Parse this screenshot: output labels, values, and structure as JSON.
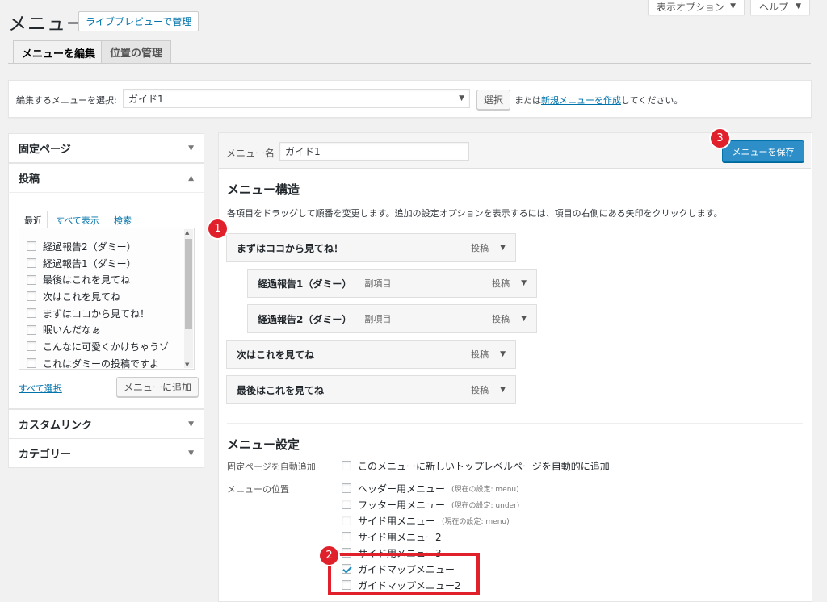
{
  "header": {
    "title": "メニュー",
    "live_preview_button": "ライブプレビューで管理",
    "screen_options": "表示オプション",
    "help": "ヘルプ",
    "caret": "▼"
  },
  "tabs": [
    {
      "label": "メニューを編集",
      "active": true
    },
    {
      "label": "位置の管理",
      "active": false
    }
  ],
  "select_bar": {
    "label": "編集するメニューを選択:",
    "selected": "ガイド1",
    "select_button": "選択",
    "or_text": "または",
    "create_link": "新規メニューを作成",
    "suffix": "してください。"
  },
  "left_panel": {
    "pages_title": "固定ページ",
    "posts_title": "投稿",
    "post_tabs": [
      "最近",
      "すべて表示",
      "検索"
    ],
    "posts": [
      "経過報告2（ダミー）",
      "経過報告1（ダミー）",
      "最後はこれを見てね",
      "次はこれを見てね",
      "まずはココから見てね！",
      "眠いんだなぁ",
      "こんなに可愛くかけちゃうゾ",
      "これはダミーの投稿ですよ"
    ],
    "select_all": "すべて選択",
    "add_to_menu": "メニューに追加",
    "custom_links_title": "カスタムリンク",
    "categories_title": "カテゴリー"
  },
  "right_panel": {
    "menu_name_label": "メニュー名",
    "menu_name_value": "ガイド1",
    "save_button": "メニューを保存",
    "structure_title": "メニュー構造",
    "structure_desc": "各項目をドラッグして順番を変更します。追加の設定オプションを表示するには、項目の右側にある矢印をクリックします。",
    "items": [
      {
        "title": "まずはココから見てね！",
        "sub": "",
        "type": "投稿"
      },
      {
        "title": "経過報告1（ダミー）",
        "sub": "副項目",
        "type": "投稿"
      },
      {
        "title": "経過報告2（ダミー）",
        "sub": "副項目",
        "type": "投稿"
      },
      {
        "title": "次はこれを見てね",
        "sub": "",
        "type": "投稿"
      },
      {
        "title": "最後はこれを見てね",
        "sub": "",
        "type": "投稿"
      }
    ],
    "settings_title": "メニュー設定",
    "auto_add_label": "固定ページを自動追加",
    "auto_add_option": "このメニューに新しいトップレベルページを自動的に追加",
    "location_label": "メニューの位置",
    "locations": [
      {
        "label": "ヘッダー用メニュー",
        "note": "(現在の設定: menu)",
        "checked": false
      },
      {
        "label": "フッター用メニュー",
        "note": "(現在の設定: under)",
        "checked": false
      },
      {
        "label": "サイド用メニュー",
        "note": "(現在の設定: menu)",
        "checked": false
      },
      {
        "label": "サイド用メニュー2",
        "note": "",
        "checked": false
      },
      {
        "label": "サイド用メニュー3",
        "note": "",
        "checked": false
      },
      {
        "label": "ガイドマップメニュー",
        "note": "",
        "checked": true
      },
      {
        "label": "ガイドマップメニュー2",
        "note": "",
        "checked": false
      }
    ]
  },
  "annotations": {
    "badge1": "1",
    "badge2": "2",
    "badge3": "3",
    "highlight_color": "#e0202a"
  },
  "colors": {
    "primary_button": "#2e8fc8",
    "link": "#0073aa"
  }
}
